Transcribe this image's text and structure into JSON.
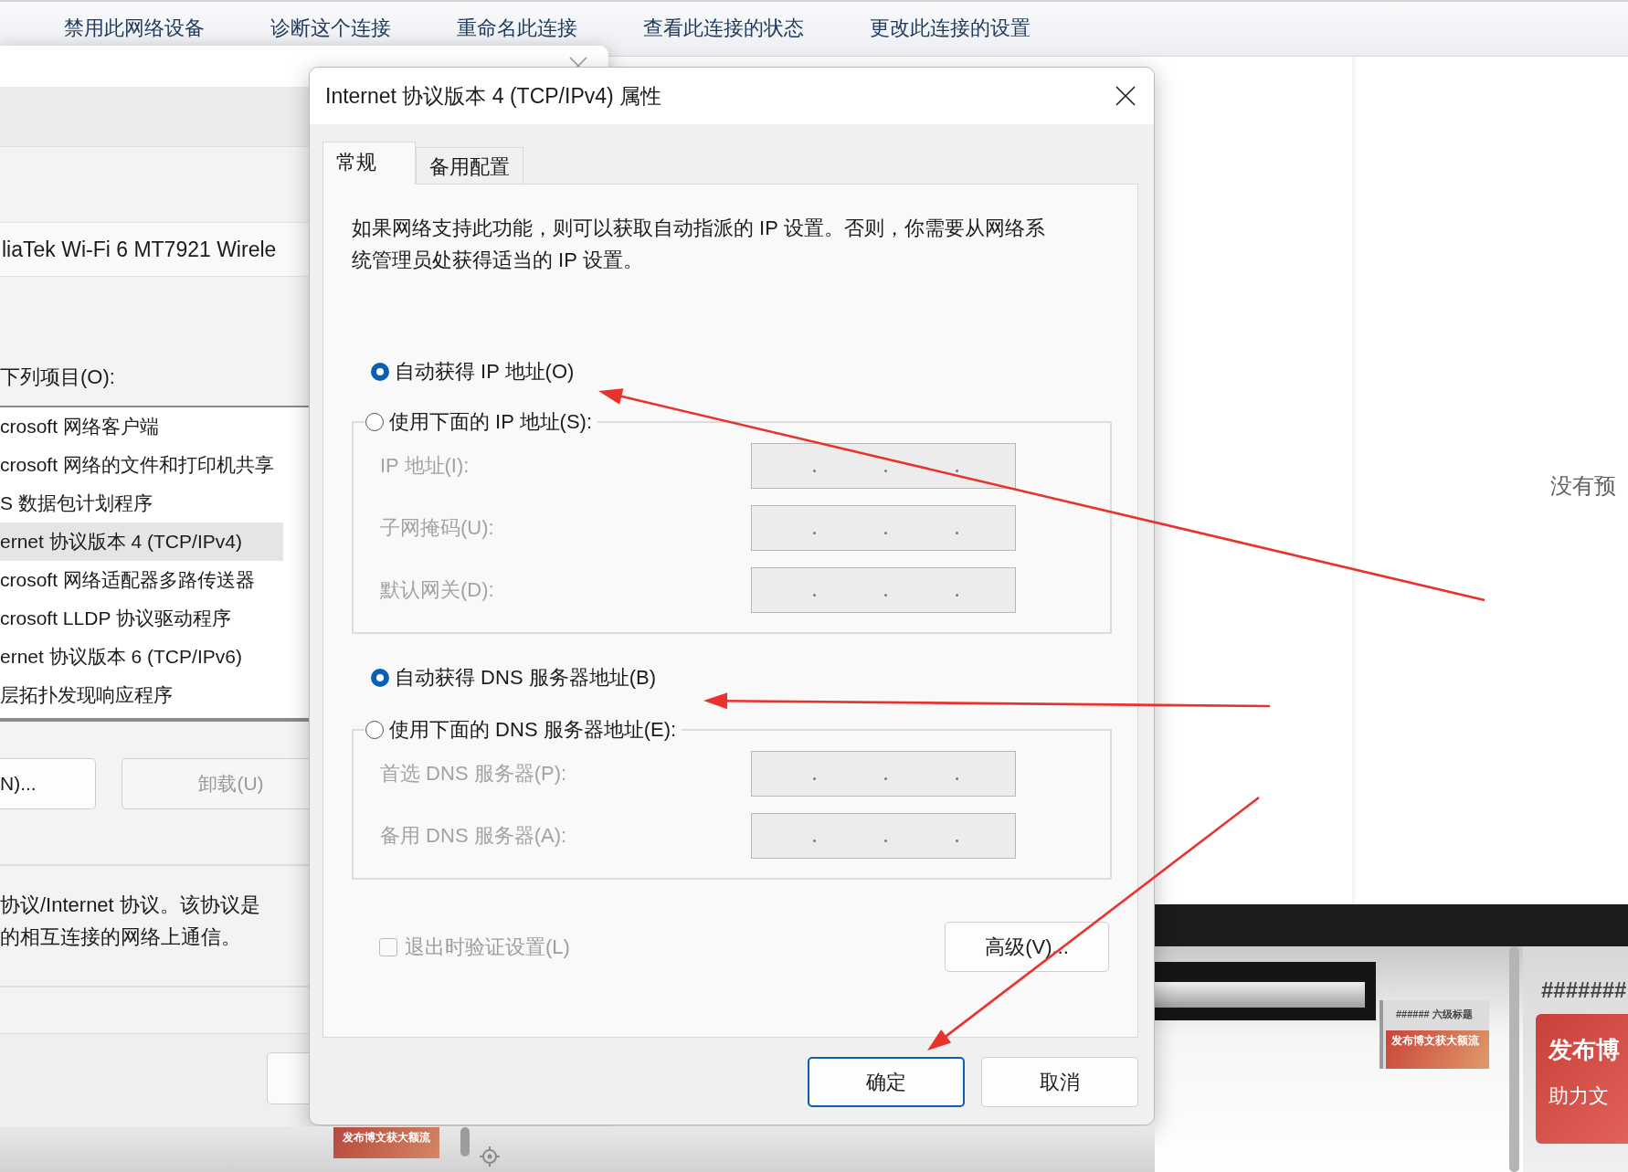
{
  "toolbar": {
    "items": [
      "禁用此网络设备",
      "诊断这个连接",
      "重命名此连接",
      "查看此连接的状态",
      "更改此连接的设置"
    ]
  },
  "back_dialog": {
    "adapter": "liaTek Wi-Fi 6 MT7921 Wirele",
    "items_label": "下列项目(O):",
    "items": [
      {
        "label": "crosoft 网络客户端",
        "selected": false
      },
      {
        "label": "crosoft 网络的文件和打印机共享",
        "selected": false
      },
      {
        "label": "S 数据包计划程序",
        "selected": false
      },
      {
        "label": "ernet 协议版本 4 (TCP/IPv4)",
        "selected": true
      },
      {
        "label": "crosoft 网络适配器多路传送器",
        "selected": false
      },
      {
        "label": "crosoft LLDP 协议驱动程序",
        "selected": false
      },
      {
        "label": "ernet 协议版本 6 (TCP/IPv6)",
        "selected": false
      },
      {
        "label": "层拓扑发现响应程序",
        "selected": false
      }
    ],
    "buttons": [
      {
        "label": "N)...",
        "disabled": false
      },
      {
        "label": "卸载(U)",
        "disabled": true
      }
    ],
    "description": [
      "协议/Internet 协议。该协议是",
      "的相互连接的网络上通信。"
    ]
  },
  "dialog": {
    "title": "Internet 协议版本 4 (TCP/IPv4) 属性",
    "tabs": [
      {
        "label": "常规",
        "selected": true
      },
      {
        "label": "备用配置",
        "selected": false
      }
    ],
    "intro": "如果网络支持此功能，则可以获取自动指派的 IP 设置。否则，你需要从网络系统管理员处获得适当的 IP 设置。",
    "ip_modes": [
      {
        "label": "自动获得 IP 地址(O)",
        "selected": true
      },
      {
        "label": "使用下面的 IP 地址(S):",
        "selected": false
      }
    ],
    "ip_fields": [
      {
        "label": "IP 地址(I):",
        "disabled": true
      },
      {
        "label": "子网掩码(U):",
        "disabled": true
      },
      {
        "label": "默认网关(D):",
        "disabled": true
      }
    ],
    "dns_modes": [
      {
        "label": "自动获得 DNS 服务器地址(B)",
        "selected": true
      },
      {
        "label": "使用下面的 DNS 服务器地址(E):",
        "selected": false
      }
    ],
    "dns_fields": [
      {
        "label": "首选 DNS 服务器(P):",
        "disabled": true
      },
      {
        "label": "备用 DNS 服务器(A):",
        "disabled": true
      }
    ],
    "validate": {
      "label": "退出时验证设置(L)",
      "checked": false,
      "disabled": true
    },
    "advanced_button": "高级(V)...",
    "buttons": [
      {
        "label": "确定",
        "default": true
      },
      {
        "label": "取消",
        "default": false
      }
    ]
  },
  "preview": {
    "message": "没有预"
  },
  "thumbnails": {
    "small_heading": "###### 六级标题",
    "small_banner": "发布博文获大额流",
    "big_heading": "#######",
    "big_banner": [
      "发布博",
      "助力文"
    ],
    "mini_banner": "发布博文获大额流"
  }
}
